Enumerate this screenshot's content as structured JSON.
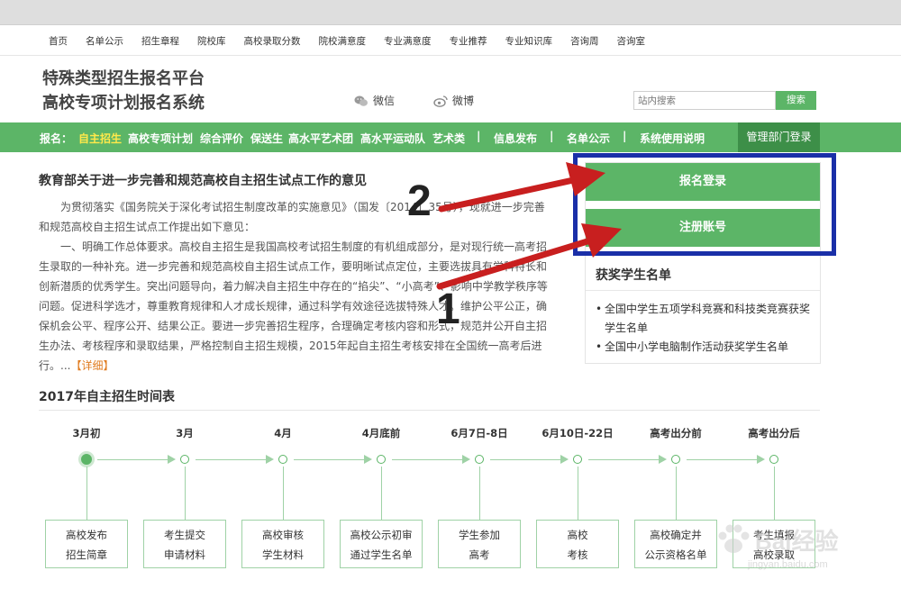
{
  "topnav": [
    "首页",
    "名单公示",
    "招生章程",
    "院校库",
    "高校录取分数",
    "院校满意度",
    "专业满意度",
    "专业推荐",
    "专业知识库",
    "咨询周",
    "咨询室"
  ],
  "brand": {
    "line1": "特殊类型招生报名平台",
    "line2": "高校专项计划报名系统"
  },
  "social": {
    "wechat": "微信",
    "weibo": "微博",
    "wechat_icon": "wechat-icon",
    "weibo_icon": "weibo-icon"
  },
  "search": {
    "placeholder": "站内搜索",
    "button": "搜索"
  },
  "greenbar": {
    "label": "报名：",
    "active": "自主招生",
    "items": [
      "高校专项计划",
      "综合评价",
      "保送生",
      "高水平艺术团",
      "高水平运动队",
      "艺术类"
    ],
    "sep": "|",
    "links": [
      "信息发布",
      "名单公示",
      "系统使用说明"
    ],
    "admin": "管理部门登录"
  },
  "article": {
    "title": "教育部关于进一步完善和规范高校自主招生试点工作的意见",
    "para1": "为贯彻落实《国务院关于深化考试招生制度改革的实施意见》（国发〔2014〕35号），现就进一步完善和规范高校自主招生试点工作提出如下意见：",
    "para2": "一、明确工作总体要求。高校自主招生是我国高校考试招生制度的有机组成部分，是对现行统一高考招生录取的一种补充。进一步完善和规范高校自主招生试点工作，要明晰试点定位，主要选拔具有学科特长和创新潜质的优秀学生。突出问题导向，着力解决自主招生中存在的“掐尖”、“小高考”、影响中学教学秩序等问题。促进科学选才，尊重教育规律和人才成长规律，通过科学有效途径选拔特殊人才。维护公平公正，确保机会公平、程序公开、结果公正。要进一步完善招生程序，合理确定考核内容和形式，规范并公开自主招生办法、考核程序和录取结果，严格控制自主招生规模，2015年起自主招生考核安排在全国统一高考后进行。...",
    "more": "【详细】"
  },
  "sidebar": {
    "login_button": "报名登录",
    "register_button": "注册账号",
    "award_title": "获奖学生名单",
    "award_items": [
      "全国中学生五项学科竞赛和科技类竞赛获奖学生名单",
      "全国中小学电脑制作活动获奖学生名单"
    ]
  },
  "timeline": {
    "title": "2017年自主招生时间表",
    "steps": [
      {
        "date": "3月初",
        "text": "高校发布\n招生简章"
      },
      {
        "date": "3月",
        "text": "考生提交\n申请材料"
      },
      {
        "date": "4月",
        "text": "高校审核\n学生材料"
      },
      {
        "date": "4月底前",
        "text": "高校公示初审\n通过学生名单"
      },
      {
        "date": "6月7日-8日",
        "text": "学生参加\n高考"
      },
      {
        "date": "6月10日-22日",
        "text": "高校\n考核"
      },
      {
        "date": "高考出分前",
        "text": "高校确定并\n公示资格名单"
      },
      {
        "date": "高考出分后",
        "text": "考生填报\n高校录取"
      }
    ]
  },
  "annotations": {
    "num1": "1",
    "num2": "2",
    "arrow_color": "#c81f1f",
    "box_color": "#1a2fa8"
  },
  "watermark": {
    "text": "Bai经验",
    "url": "jingyan.baidu.com"
  },
  "colors": {
    "green": "#5cb567",
    "dark_green": "#3d8f48",
    "highlight_yellow": "#ffe94a",
    "link_orange": "#e07b1f"
  }
}
